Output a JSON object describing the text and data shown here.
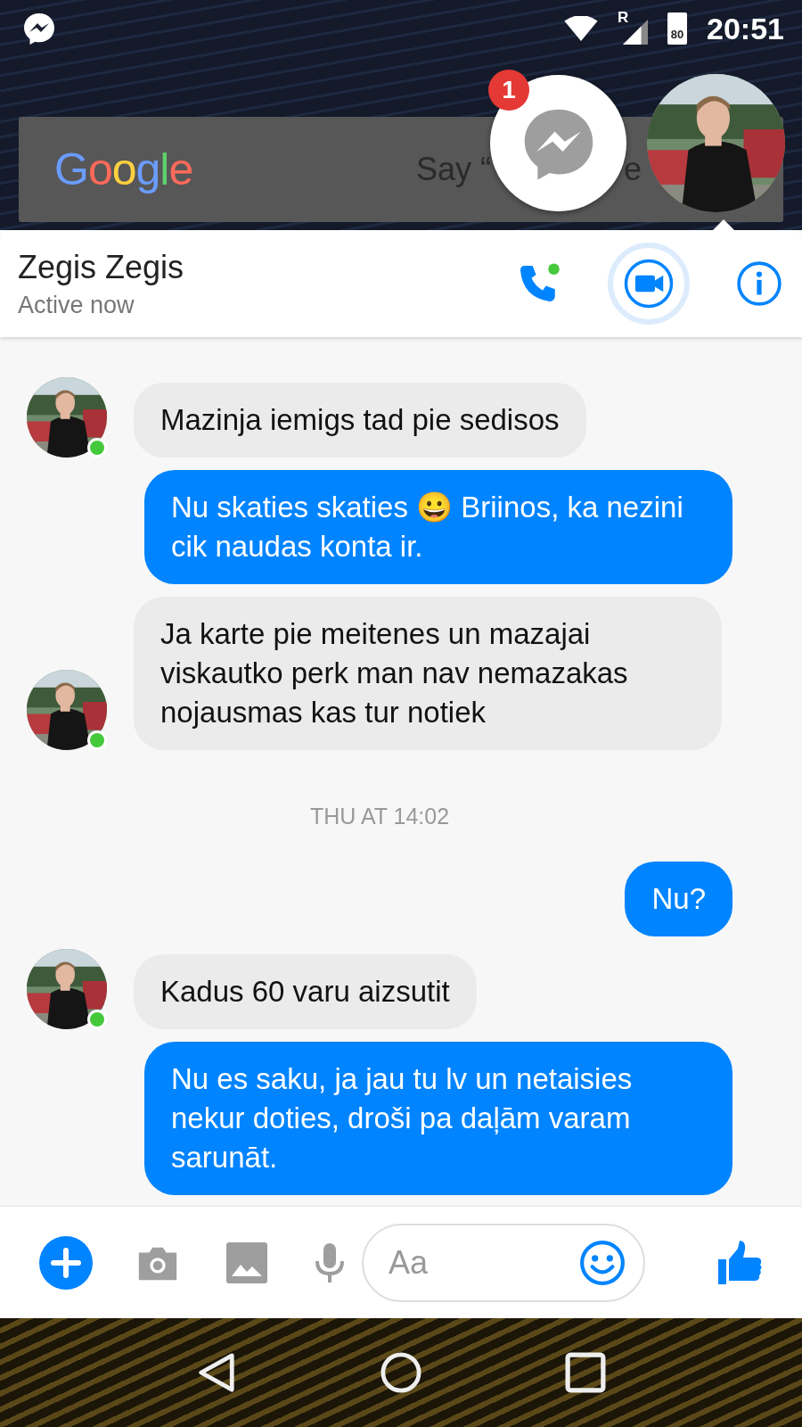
{
  "status_bar": {
    "network_label": "R",
    "battery": "80",
    "time": "20:51"
  },
  "search_widget": {
    "logo": "Google",
    "hint_start": "Say “",
    "hint_end": "e"
  },
  "chat_head": {
    "badge": "1"
  },
  "header": {
    "name": "Zegis Zegis",
    "status": "Active now",
    "call_online": true
  },
  "messages": [
    {
      "kind": "received",
      "text": "Mazinja iemigs tad pie sedisos",
      "avatar": true,
      "online": true
    },
    {
      "kind": "sent",
      "text": "Nu skaties skaties 😀 Briinos, ka nezini cik naudas konta ir."
    },
    {
      "kind": "received",
      "text": "Ja karte pie meitenes un mazajai viskautko perk  man nav nemazakas nojausmas kas tur notiek",
      "avatar": true,
      "online": true
    },
    {
      "kind": "time",
      "text": "THU AT 14:02"
    },
    {
      "kind": "sent",
      "text": "Nu?"
    },
    {
      "kind": "received",
      "text": "Kadus 60 varu aizsutit",
      "avatar": true,
      "online": true
    },
    {
      "kind": "sent",
      "text": "Nu es saku, ja jau tu lv un netaisies nekur doties, droši pa daļām varam sarunāt."
    }
  ],
  "composer": {
    "placeholder": "Aa"
  }
}
